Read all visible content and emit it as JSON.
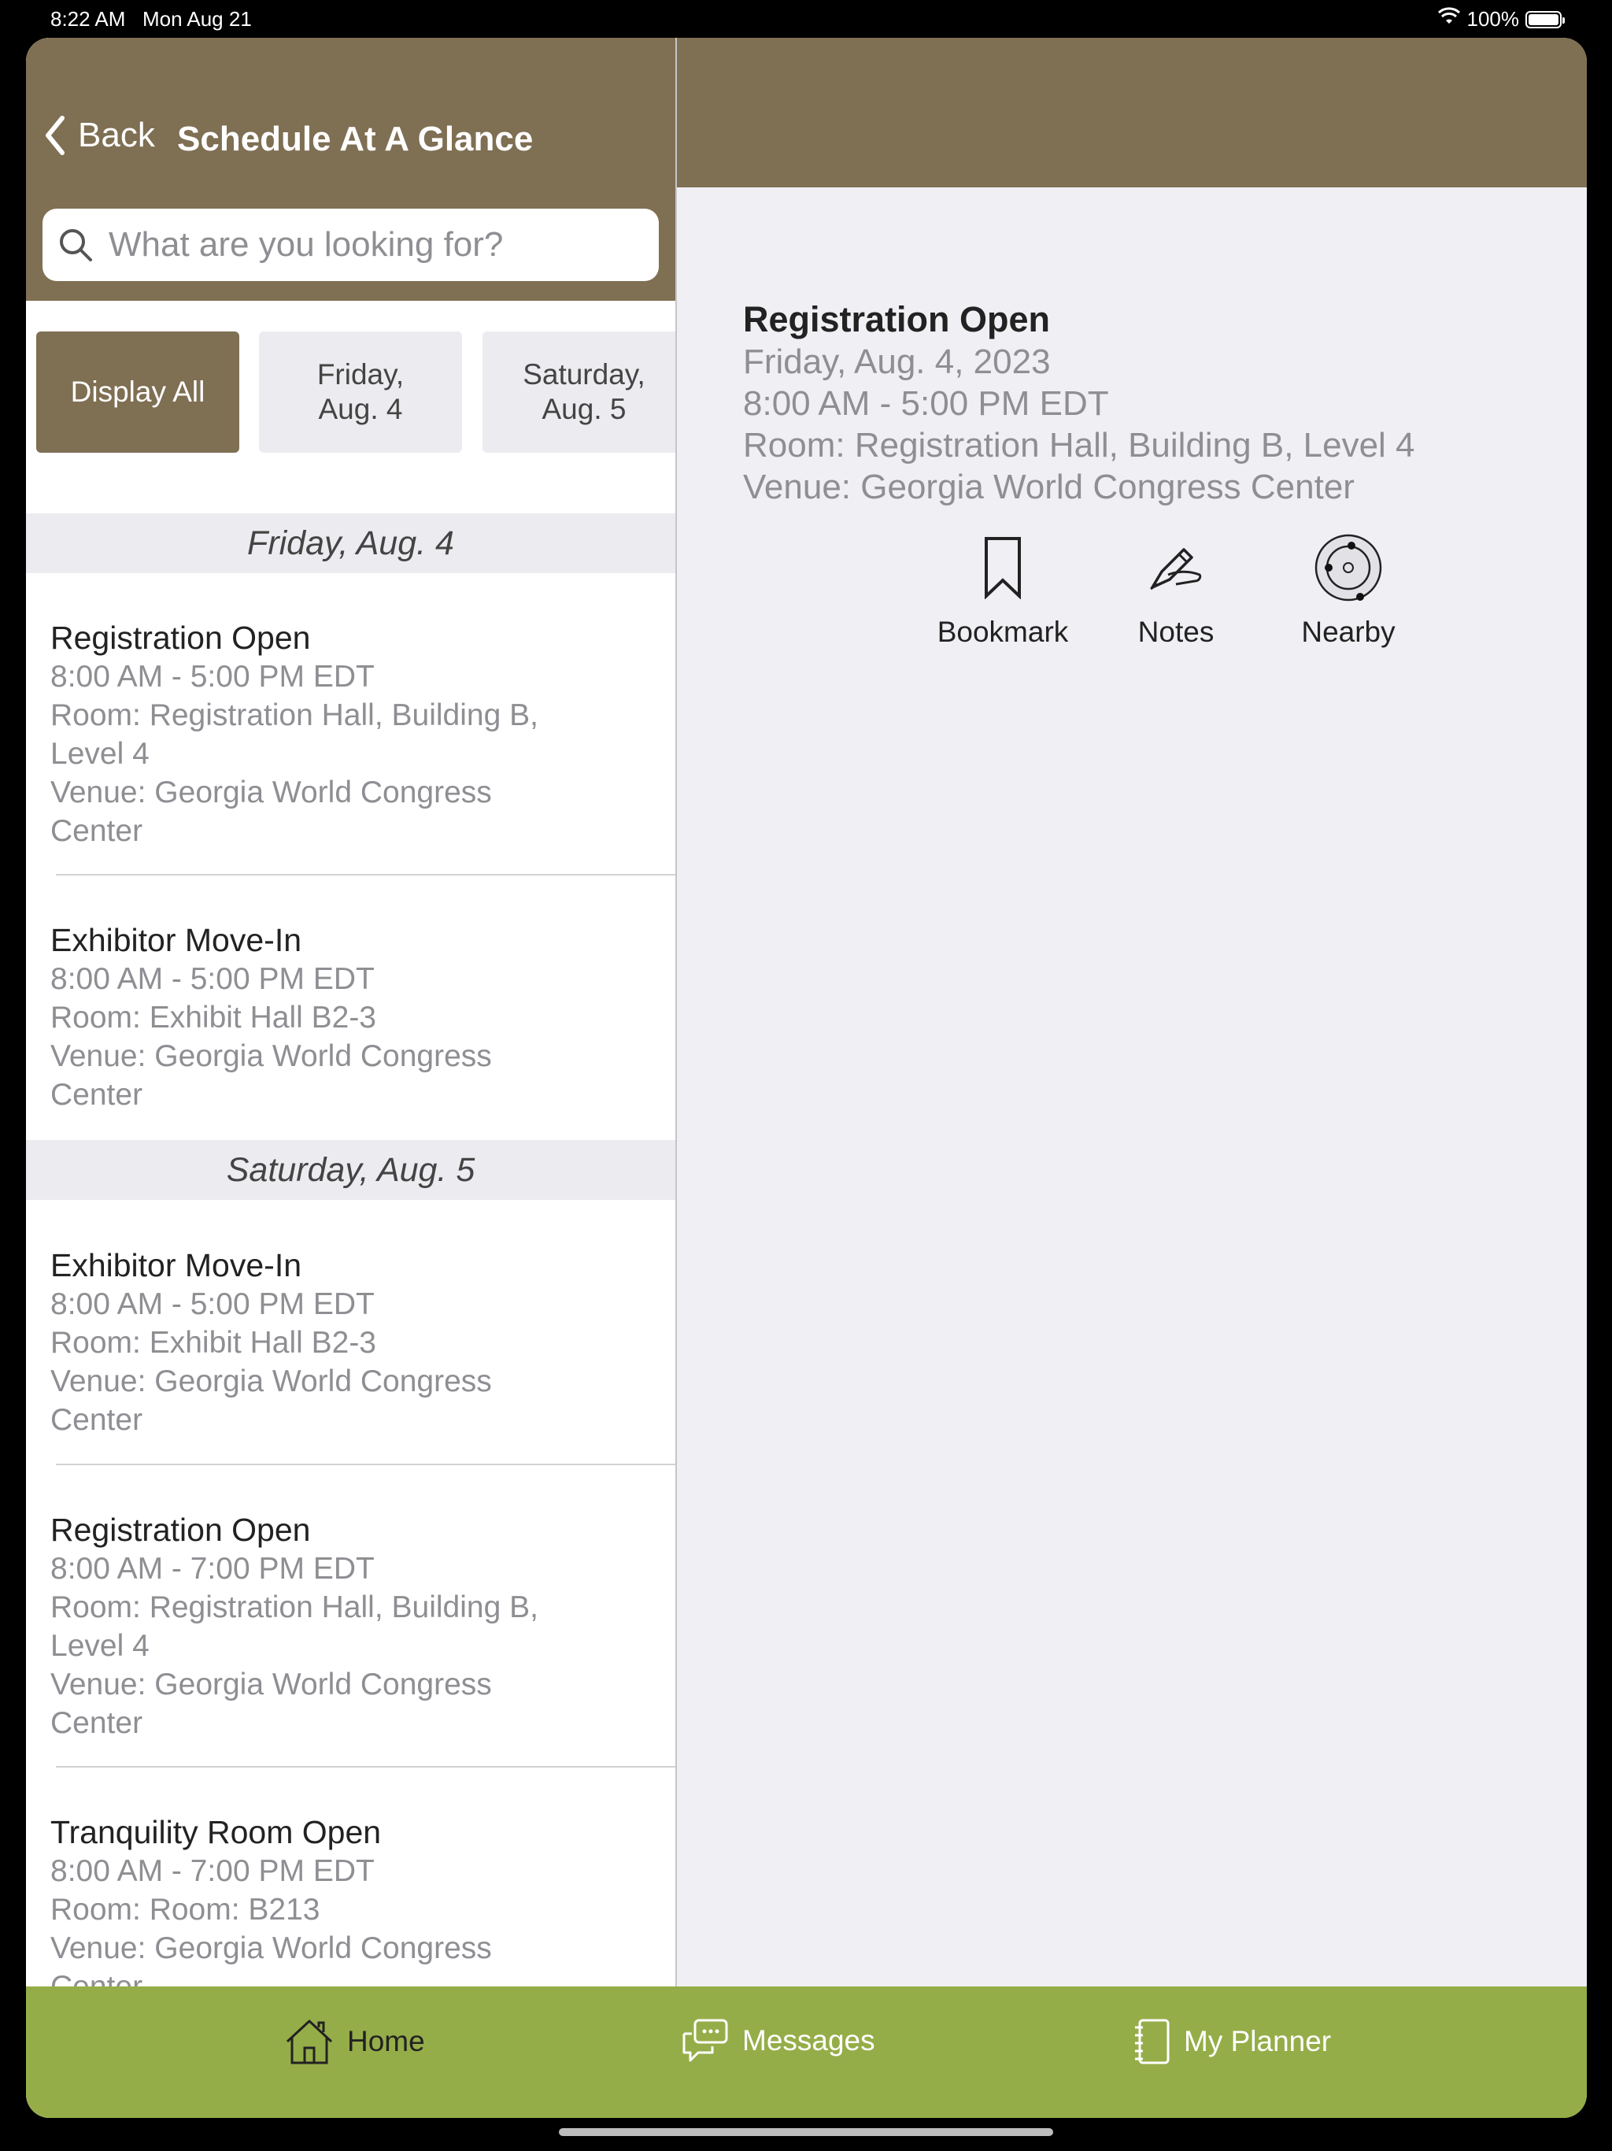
{
  "status": {
    "time": "8:22 AM",
    "date": "Mon Aug 21",
    "battery": "100%"
  },
  "nav": {
    "back_label": "Back",
    "title": "Schedule At A Glance"
  },
  "search": {
    "placeholder": "What are you looking for?"
  },
  "filters": [
    "Display All",
    "Friday,\nAug. 4",
    "Saturday,\nAug. 5"
  ],
  "list": {
    "day1": "Friday, Aug. 4",
    "day2": "Saturday, Aug. 5",
    "items": [
      {
        "title": "Registration Open",
        "meta": "8:00 AM - 5:00 PM EDT\nRoom: Registration Hall, Building B, Level 4\nVenue: Georgia World Congress Center"
      },
      {
        "title": "Exhibitor Move-In",
        "meta": "8:00 AM - 5:00 PM EDT\nRoom: Exhibit Hall B2-3\nVenue: Georgia World Congress Center"
      },
      {
        "title": "Exhibitor Move-In",
        "meta": "8:00 AM - 5:00 PM EDT\nRoom: Exhibit Hall B2-3\nVenue: Georgia World Congress Center"
      },
      {
        "title": "Registration Open",
        "meta": "8:00 AM - 7:00 PM EDT\nRoom: Registration Hall, Building B, Level 4\nVenue: Georgia World Congress Center"
      },
      {
        "title": "Tranquility Room Open",
        "meta": "8:00 AM - 7:00 PM EDT\nRoom: Room: B213\nVenue: Georgia World Congress Center"
      }
    ]
  },
  "detail": {
    "title": "Registration Open",
    "date": "Friday, Aug. 4, 2023",
    "time": "8:00 AM - 5:00 PM EDT",
    "room": "Room: Registration Hall, Building B, Level 4",
    "venue": "Venue: Georgia World Congress Center",
    "actions": [
      "Bookmark",
      "Notes",
      "Nearby"
    ]
  },
  "tabs": [
    "Home",
    "Messages",
    "My Planner"
  ],
  "colors": {
    "header": "#7f6f53",
    "tabbar": "#95ad48"
  }
}
